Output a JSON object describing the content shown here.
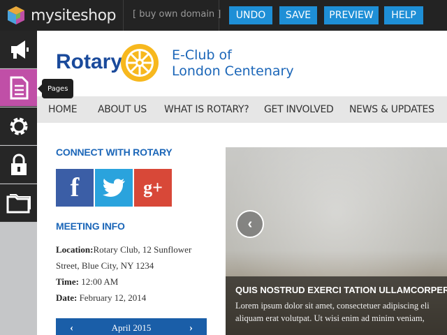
{
  "topbar": {
    "brand": "mysiteshop",
    "domain_link": "[ buy own domain ]",
    "buttons": {
      "undo": "UNDO",
      "save": "SAVE",
      "preview": "PREVIEW",
      "help": "HELP"
    },
    "button_color": "#1e8fd6"
  },
  "leftbar": {
    "items": [
      {
        "icon": "megaphone-icon"
      },
      {
        "icon": "pages-icon",
        "active": true,
        "tooltip": "Pages"
      },
      {
        "icon": "gear-icon"
      },
      {
        "icon": "lock-icon"
      },
      {
        "icon": "folder-icon"
      }
    ],
    "active_color": "#c04fa7"
  },
  "site": {
    "logo_word": "Rotary",
    "club_line1": "E-Club of",
    "club_line2": "London Centenary",
    "nav": [
      "HOME",
      "ABOUT US",
      "WHAT IS ROTARY?",
      "GET INVOLVED",
      "NEWS & UPDATES"
    ],
    "connect_title": "CONNECT WITH ROTARY",
    "social": {
      "facebook": "f",
      "google": "g+"
    },
    "meeting_title": "MEETING INFO",
    "meeting": {
      "location_label": "Location:",
      "location_value_1": "Rotary Club, 12 Sunflower",
      "location_value_2": "Street, Blue City, NY 1234",
      "time_label": "Time:",
      "time_value": "12:00 AM",
      "date_label": "Date:",
      "date_value": "February 12, 2014"
    },
    "calendar": {
      "month": "April 2015",
      "prev": "‹",
      "next": "›"
    },
    "slider": {
      "prev": "‹",
      "caption_title": "QUIS NOSTRUD EXERCI TATION ULLAMCORPER",
      "caption_line1": "Lorem ipsum dolor sit amet, consectetuer adipiscing eli",
      "caption_line2": "aliquam erat volutpat. Ut wisi enim ad minim veniam,"
    }
  }
}
